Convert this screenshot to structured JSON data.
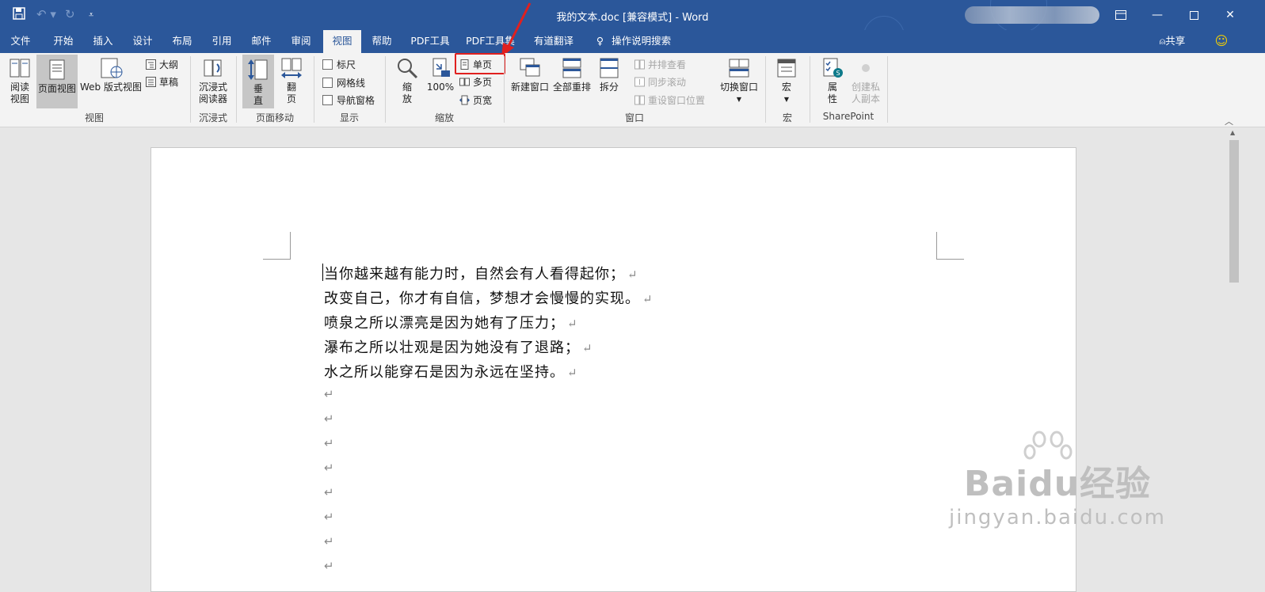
{
  "window": {
    "title": "我的文本.doc [兼容模式]  -  Word"
  },
  "quick_access": {
    "save_icon": "save-icon",
    "undo_icon": "undo-icon",
    "redo_icon": "redo-icon",
    "customize_icon": "customize-dropdown-icon"
  },
  "tabs": [
    {
      "label": "文件"
    },
    {
      "label": "开始"
    },
    {
      "label": "插入"
    },
    {
      "label": "设计"
    },
    {
      "label": "布局"
    },
    {
      "label": "引用"
    },
    {
      "label": "邮件"
    },
    {
      "label": "审阅"
    },
    {
      "label": "视图"
    },
    {
      "label": "帮助"
    },
    {
      "label": "PDF工具"
    },
    {
      "label": "PDF工具集"
    },
    {
      "label": "有道翻译"
    },
    {
      "label": "操作说明搜索"
    }
  ],
  "share_label": "共享",
  "ribbon": {
    "views": {
      "read_mode": [
        "阅读",
        "视图"
      ],
      "print_layout": "页面视图",
      "web_layout": "Web 版式视图",
      "outline": "大纲",
      "draft": "草稿",
      "group": "视图"
    },
    "immersive": {
      "reader": [
        "沉浸式",
        "阅读器"
      ],
      "group": "沉浸式"
    },
    "page_move": {
      "vertical": [
        "垂",
        "直"
      ],
      "side_to_side": [
        "翻",
        "页"
      ],
      "group": "页面移动"
    },
    "show": {
      "ruler": "标尺",
      "gridlines": "网格线",
      "nav_pane": "导航窗格",
      "group": "显示"
    },
    "zoom": {
      "zoom": [
        "缩",
        "放"
      ],
      "hundred": "100%",
      "one_page": "单页",
      "multiple_pages": "多页",
      "page_width": "页宽",
      "group": "缩放"
    },
    "window": {
      "new_window": "新建窗口",
      "arrange_all": "全部重排",
      "split": "拆分",
      "side_by_side": "并排查看",
      "sync_scroll": "同步滚动",
      "reset_position": "重设窗口位置",
      "switch_windows": "切换窗口",
      "group": "窗口"
    },
    "macros": {
      "macros": "宏",
      "group": "宏"
    },
    "sharepoint": {
      "properties": [
        "属",
        "性"
      ],
      "private_copy": [
        "创建私",
        "人副本"
      ],
      "group": "SharePoint"
    }
  },
  "document": {
    "lines": [
      "当你越来越有能力时，自然会有人看得起你；",
      "改变自己，你才有自信，梦想才会慢慢的实现。",
      "喷泉之所以漂亮是因为她有了压力；",
      "瀑布之所以壮观是因为她没有了退路；",
      "水之所以能穿石是因为永远在坚持。"
    ],
    "paragraph_mark": "↵",
    "empty_paragraph_count": 8
  },
  "watermark": {
    "brand": "Baidu经验",
    "url": "jingyan.baidu.com"
  },
  "colors": {
    "title_bar": "#2b579a",
    "ribbon": "#f3f3f3",
    "highlight": "#e0201f"
  }
}
